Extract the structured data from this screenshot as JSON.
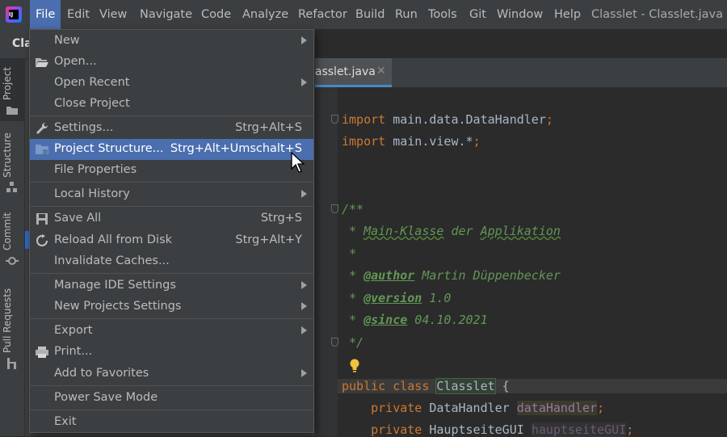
{
  "menubar": {
    "items": [
      "File",
      "Edit",
      "View",
      "Navigate",
      "Code",
      "Analyze",
      "Refactor",
      "Build",
      "Run",
      "Tools",
      "Git",
      "Window",
      "Help"
    ],
    "window_title": "Classlet - Classlet.java"
  },
  "project_bar": {
    "label": "Cla"
  },
  "tool_tabs": [
    "Project",
    "Structure",
    "Commit",
    "Pull Requests"
  ],
  "editor": {
    "tab_label": "lasslet.java",
    "close_glyph": "✕"
  },
  "code": {
    "l1_kw": "import",
    "l1_id": " main.data.DataHandler",
    "l1_semi": ";",
    "l2_kw": "import",
    "l2_id": " main.view.*",
    "l2_semi": ";",
    "c1": "/**",
    "c2a": " * ",
    "c2b": "Main-Klasse",
    "c2c": " der ",
    "c2d": "Applikation",
    "c3": " *",
    "c4a": " * ",
    "c4tag": "@author",
    "c4b": " Martin Düppenbecker",
    "c5a": " * ",
    "c5tag": "@version",
    "c5b": " 1.0",
    "c6a": " * ",
    "c6tag": "@since",
    "c6b": " 04.10.2021",
    "c7": " */",
    "cls_kw": "public class",
    "cls_name": "Classlet",
    "cls_brace": " {",
    "f1_kw": "    private",
    "f1_type": " DataHandler ",
    "f1_name": "dataHandler",
    "f1_semi": ";",
    "f2_kw": "    private",
    "f2_type": " HauptseiteGUI ",
    "f2_name": "hauptseiteGUI",
    "f2_semi": ";"
  },
  "file_menu": {
    "new": "New",
    "open": "Open...",
    "open_recent": "Open Recent",
    "close_project": "Close Project",
    "settings": "Settings...",
    "settings_sc": "Strg+Alt+S",
    "project_structure": "Project Structure...",
    "project_structure_sc": "Strg+Alt+Umschalt+S",
    "file_properties": "File Properties",
    "local_history": "Local History",
    "save_all": "Save All",
    "save_all_sc": "Strg+S",
    "reload": "Reload All from Disk",
    "reload_sc": "Strg+Alt+Y",
    "invalidate": "Invalidate Caches...",
    "manage_ide": "Manage IDE Settings",
    "new_projects_settings": "New Projects Settings",
    "export": "Export",
    "print": "Print...",
    "add_favorites": "Add to Favorites",
    "power_save": "Power Save Mode",
    "exit": "Exit"
  },
  "colors": {
    "accent": "#4b6eaf",
    "menu_bg": "#3c3f41",
    "editor_bg": "#2b2b2b",
    "keyword": "#cc7832",
    "comment": "#629755"
  }
}
